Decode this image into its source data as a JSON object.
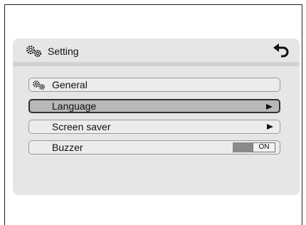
{
  "header": {
    "title": "Setting",
    "icon": "gears-icon",
    "back_icon": "back-arrow-icon"
  },
  "menu": {
    "items": [
      {
        "label": "General",
        "icon": "gears-icon",
        "selected": false
      },
      {
        "label": "Language",
        "arrow": "right-triangle-icon",
        "selected": true
      },
      {
        "label": "Screen saver",
        "arrow": "right-triangle-icon",
        "selected": false
      },
      {
        "label": "Buzzer",
        "toggle": {
          "state_label": "ON",
          "value": "on"
        },
        "selected": false
      }
    ]
  },
  "colors": {
    "panel": "#e6e6e6",
    "selected_row": "#b8b8b8",
    "toggle_off": "#8a8a8a"
  }
}
